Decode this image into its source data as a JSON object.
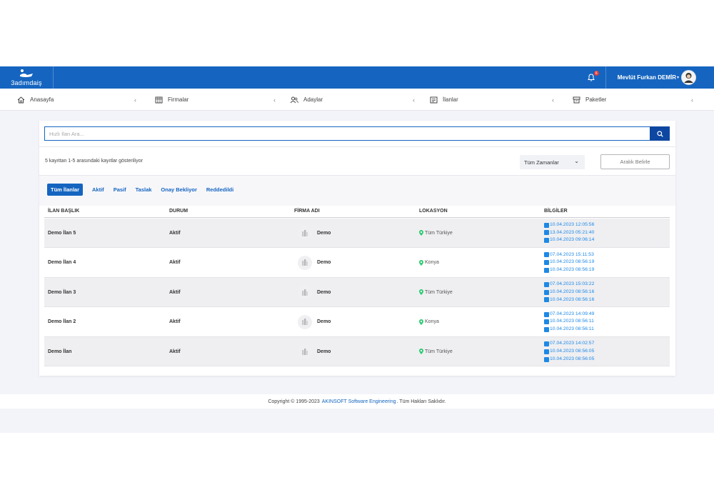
{
  "header": {
    "logo_text": "3adımdaiş",
    "notification_count": "6",
    "user_name": "Mevlüt Furkan DEMİR",
    "accent": "#1565c0"
  },
  "nav": {
    "items": [
      {
        "label": "Anasayfa",
        "icon": "home-icon"
      },
      {
        "label": "Firmalar",
        "icon": "table-icon"
      },
      {
        "label": "Adaylar",
        "icon": "users-icon"
      },
      {
        "label": "İlanlar",
        "icon": "list-icon"
      },
      {
        "label": "Paketler",
        "icon": "package-icon"
      }
    ]
  },
  "search": {
    "placeholder": "Hızlı İlan Ara..."
  },
  "summary": "5 kayıttan 1-5 arasındaki kayıtlar gösteriliyor",
  "filter": {
    "time_value": "Tüm Zamanlar",
    "range_button": "Aralık Belirle"
  },
  "tabs": [
    {
      "label": "Tüm İlanlar",
      "active": true
    },
    {
      "label": "Aktif"
    },
    {
      "label": "Pasif"
    },
    {
      "label": "Taslak"
    },
    {
      "label": "Onay Bekliyor"
    },
    {
      "label": "Reddedildi"
    }
  ],
  "table": {
    "columns": [
      "İLAN BAŞLIK",
      "DURUM",
      "FİRMA ADI",
      "LOKASYON",
      "BİLGİLER"
    ],
    "rows": [
      {
        "title": "Demo İlan 5",
        "status": "Aktif",
        "company": "Demo",
        "location": "Tüm Türkiye",
        "dates": [
          "10.04.2023 12:05:56",
          "13.04.2023 05:21:40",
          "10.04.2023 09:06:14"
        ]
      },
      {
        "title": "Demo İlan 4",
        "status": "Aktif",
        "company": "Demo",
        "location": "Konya",
        "dates": [
          "07.04.2023 15:11:53",
          "10.04.2023 08:56:19",
          "10.04.2023 08:56:19"
        ]
      },
      {
        "title": "Demo İlan 3",
        "status": "Aktif",
        "company": "Demo",
        "location": "Tüm Türkiye",
        "dates": [
          "07.04.2023 15:03:22",
          "10.04.2023 08:56:16",
          "10.04.2023 08:56:16"
        ]
      },
      {
        "title": "Demo İlan 2",
        "status": "Aktif",
        "company": "Demo",
        "location": "Konya",
        "dates": [
          "07.04.2023 14:09:49",
          "10.04.2023 08:56:11",
          "10.04.2023 08:56:11"
        ]
      },
      {
        "title": "Demo İlan",
        "status": "Aktif",
        "company": "Demo",
        "location": "Tüm Türkiye",
        "dates": [
          "07.04.2023 14:02:57",
          "10.04.2023 08:56:05",
          "10.04.2023 08:56:05"
        ]
      }
    ]
  },
  "footer": {
    "prefix": "Copyright © 1995-2023",
    "link": "AKINSOFT Software Engineering",
    "suffix": ". Tüm Hakları Saklıdır."
  }
}
